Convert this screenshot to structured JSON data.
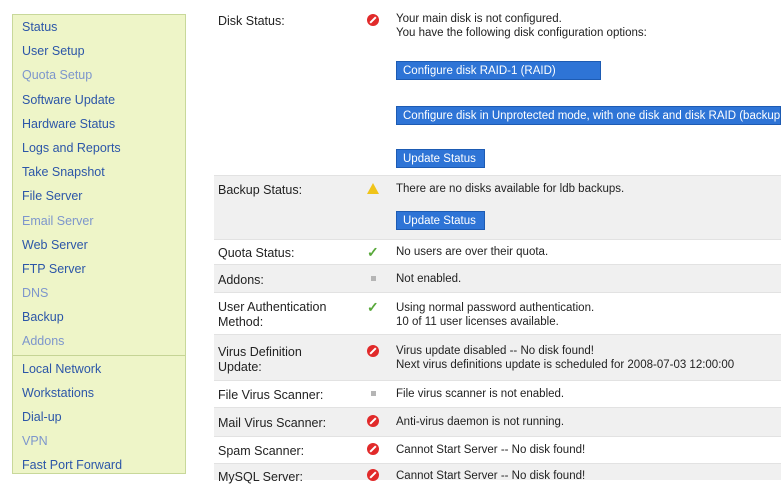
{
  "sidebar": {
    "items": [
      {
        "label": "Status"
      },
      {
        "label": "User Setup"
      },
      {
        "label": "Quota Setup"
      },
      {
        "label": "Software Update"
      },
      {
        "label": "Hardware Status"
      },
      {
        "label": "Logs and Reports"
      },
      {
        "label": "Take Snapshot"
      },
      {
        "label": "File Server"
      },
      {
        "label": "Email Server"
      },
      {
        "label": "Web Server"
      },
      {
        "label": "FTP Server"
      },
      {
        "label": "DNS"
      },
      {
        "label": "Backup"
      },
      {
        "label": "Addons"
      },
      {
        "label": "Local Network"
      },
      {
        "label": "Workstations"
      },
      {
        "label": "Dial-up"
      },
      {
        "label": "VPN"
      },
      {
        "label": "Fast Port Forward"
      }
    ]
  },
  "status": {
    "disk": {
      "label": "Disk Status:",
      "icon": "error-icon",
      "message1": "Your main disk is not configured.",
      "message2": "You have the following disk configuration options:",
      "button1": "Configure disk RAID-1 (RAID)",
      "button2": "Configure disk in Unprotected mode, with one disk and disk RAID (backup)",
      "button3": "Update Status"
    },
    "backup": {
      "label": "Backup Status:",
      "icon": "warning-icon",
      "message": "There are no disks available for ldb backups.",
      "button": "Update Status"
    },
    "quota": {
      "label": "Quota Status:",
      "icon": "check-icon",
      "message": "No users are over their quota."
    },
    "addons": {
      "label": "Addons:",
      "icon": "neutral-icon",
      "message": "Not enabled."
    },
    "auth": {
      "label1": "User Authentication",
      "label2": "Method:",
      "icon": "check-icon",
      "message1": "Using normal password authentication.",
      "message2": "10 of 11 user licenses available."
    },
    "virus_def": {
      "label1": "Virus Definition",
      "label2": "Update:",
      "icon": "error-icon",
      "message1": "Virus update disabled -- No disk found!",
      "message2": "Next virus definitions update is scheduled for 2008-07-03 12:00:00"
    },
    "file_virus": {
      "label": "File Virus Scanner:",
      "icon": "neutral-icon",
      "message": "File virus scanner is not enabled."
    },
    "mail_virus": {
      "label": "Mail Virus Scanner:",
      "icon": "error-icon",
      "message": "Anti-virus daemon is not running."
    },
    "spam": {
      "label": "Spam Scanner:",
      "icon": "error-icon",
      "message": "Cannot Start Server -- No disk found!"
    },
    "mysql": {
      "label": "MySQL Server:",
      "icon": "error-icon",
      "message": "Cannot Start Server -- No disk found!"
    }
  }
}
